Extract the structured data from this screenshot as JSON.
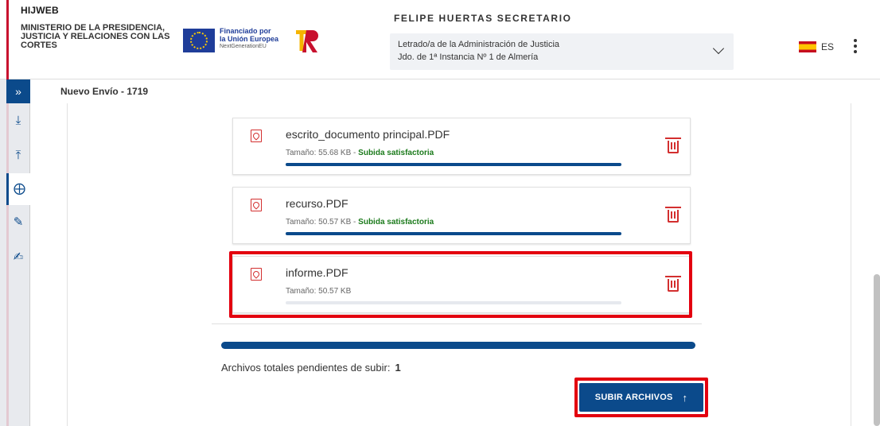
{
  "header": {
    "app_name": "HIJWEB",
    "ministry": "MINISTERIO DE LA PRESIDENCIA, JUSTICIA Y RELACIONES CON LAS CORTES",
    "eu_line1": "Financiado por",
    "eu_line2": "la Unión Europea",
    "eu_line3": "NextGenerationEU",
    "user_name": "FELIPE HUERTAS SECRETARIO",
    "role_line1": "Letrado/a de la Administración de Justicia",
    "role_line2": "Jdo. de 1ª Instancia Nº 1 de Almería",
    "language": "ES"
  },
  "breadcrumb": "Nuevo Envío - 1719",
  "files": [
    {
      "name": "escrito_documento principal.PDF",
      "size": "Tamaño: 55.68 KB",
      "status": "Subida satisfactoria",
      "progress": 1.0
    },
    {
      "name": "recurso.PDF",
      "size": "Tamaño: 50.57 KB",
      "status": "Subida satisfactoria",
      "progress": 1.0
    },
    {
      "name": "informe.PDF",
      "size": "Tamaño: 50.57 KB",
      "status": "",
      "progress": 0.0
    }
  ],
  "separator": " - ",
  "pending_label": "Archivos totales pendientes de subir:",
  "pending_count": "1",
  "upload_button": "SUBIR ARCHIVOS",
  "colors": {
    "primary": "#0b4a8b",
    "danger": "#d32f2f",
    "success": "#1b7a1b",
    "highlight": "#e3000f"
  },
  "icons": {
    "menu_toggle": "chevrons-right-icon",
    "pdf": "pdf-icon",
    "delete": "trash-icon",
    "upload": "arrow-up-icon"
  }
}
